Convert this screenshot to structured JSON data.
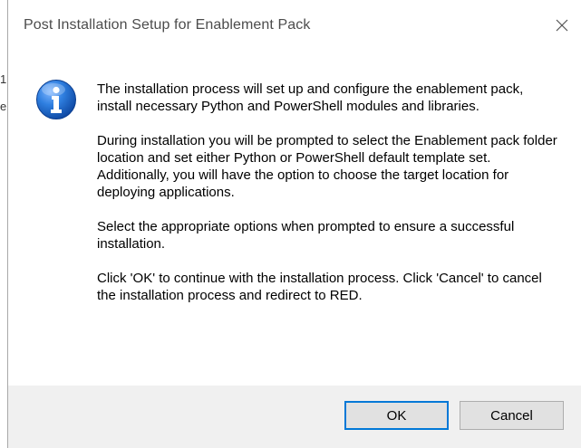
{
  "window": {
    "title": "Post Installation Setup for Enablement Pack"
  },
  "background_glyphs": {
    "a": "1",
    "b": "e"
  },
  "message": {
    "paragraphs": [
      "The installation process will set up and configure the enablement pack, install necessary Python and PowerShell modules and libraries.",
      "During installation you will be prompted to select the Enablement pack folder location and set either Python or PowerShell default template set. Additionally, you will have the option to choose the target location for deploying applications.",
      "Select the appropriate options when prompted to ensure a successful installation.",
      "Click 'OK' to continue with the installation process. Click 'Cancel' to cancel the installation process and redirect to RED."
    ]
  },
  "buttons": {
    "ok_label": "OK",
    "cancel_label": "Cancel"
  },
  "icons": {
    "close": "close-icon",
    "info": "info-icon"
  },
  "colors": {
    "info_blue": "#1565c0",
    "focus_border": "#0078d7",
    "footer_bg": "#f0f0f0"
  }
}
